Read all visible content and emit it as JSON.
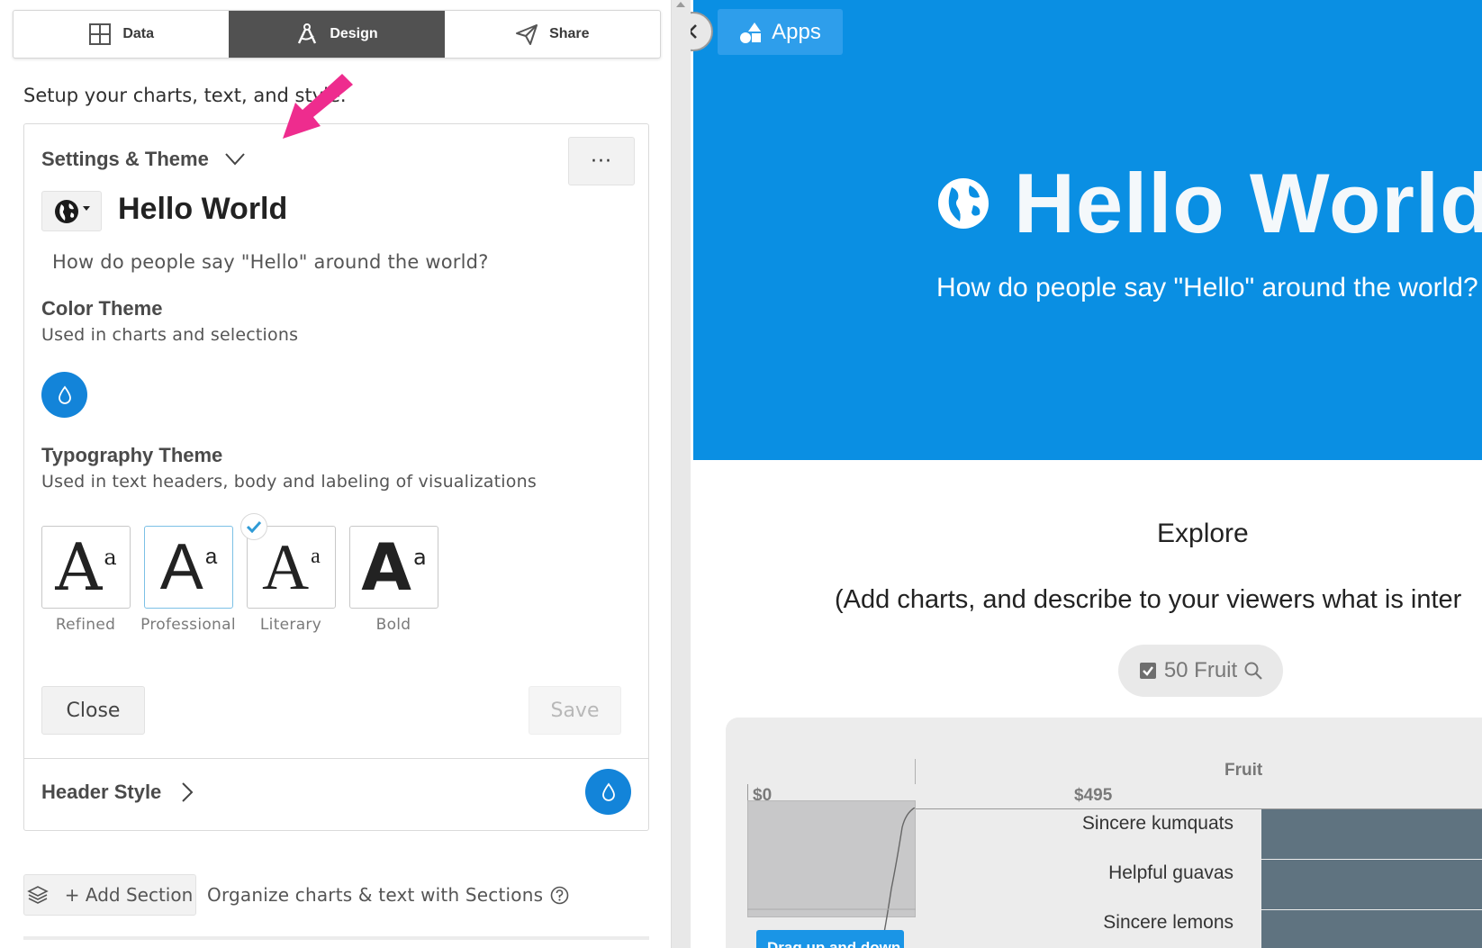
{
  "tabs": [
    {
      "label": "Data",
      "icon": "table-grid-icon",
      "active": false
    },
    {
      "label": "Design",
      "icon": "compass-pen-icon",
      "active": true
    },
    {
      "label": "Share",
      "icon": "paper-plane-icon",
      "active": false
    }
  ],
  "intro_text": "Setup your charts, text, and style.",
  "settings": {
    "title": "Settings & Theme",
    "more_label": "···",
    "app_icon": "globe-icon",
    "app_title": "Hello World",
    "subtitle": "How do people say \"Hello\" around the world?",
    "color_theme": {
      "heading": "Color Theme",
      "description": "Used in charts and selections",
      "color": "#1384d9"
    },
    "typography": {
      "heading": "Typography Theme",
      "description": "Used in text headers, body and labeling of visualizations",
      "options": [
        {
          "label": "Refined",
          "big": "A",
          "small": "a",
          "selected": false
        },
        {
          "label": "Professional",
          "big": "A",
          "small": "a",
          "selected": true
        },
        {
          "label": "Literary",
          "big": "A",
          "small": "a",
          "selected": false
        },
        {
          "label": "Bold",
          "big": "A",
          "small": "a",
          "selected": false
        }
      ]
    },
    "close_label": "Close",
    "save_label": "Save"
  },
  "header_style": {
    "label": "Header Style",
    "color": "#1384d9"
  },
  "add_section": {
    "label": "+ Add Section",
    "hint": "Organize charts & text with Sections"
  },
  "preview": {
    "apps_label": "Apps",
    "hero_title": "Hello World",
    "hero_subtitle": "How do people say \"Hello\" around the world?",
    "hero_color": "#0a8fe3",
    "explore_heading": "Explore",
    "explore_description": "(Add charts, and describe to your viewers what is inter",
    "filter_label": "50 Fruit",
    "chart": {
      "column_title": "Fruit",
      "axis_ticks": [
        "$0",
        "$495"
      ],
      "rows": [
        "Sincere kumquats",
        "Helpful guavas",
        "Sincere lemons"
      ],
      "drag_hint": "Drag up and down",
      "bar_color": "#5f7380"
    }
  }
}
